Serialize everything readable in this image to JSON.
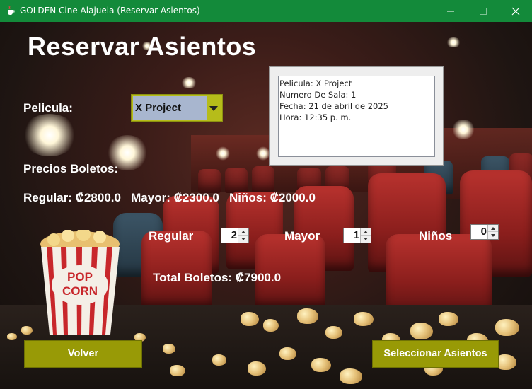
{
  "window": {
    "title": "GOLDEN Cine Alajuela (Reservar Asientos)",
    "controls": [
      "minimize",
      "maximize",
      "close"
    ]
  },
  "page": {
    "heading": "Reservar Asientos"
  },
  "movie": {
    "label": "Pelicula:",
    "selected": "X Project"
  },
  "info": {
    "lines": [
      "Pelicula: X Project",
      "Numero De Sala: 1",
      "Fecha: 21 de abril  de 2025",
      "Hora: 12:35 p. m."
    ]
  },
  "prices": {
    "heading": "Precios Boletos:",
    "summary": "Regular: ₡2800.0   Mayor: ₡2300.0   Niños: ₡2000.0"
  },
  "tickets": {
    "regular_label": "Regular",
    "regular_value": "2",
    "mayor_label": "Mayor",
    "mayor_value": "1",
    "ninos_label": "Niños",
    "ninos_value": "0"
  },
  "total": {
    "text": "Total Boletos: ₡7900.0"
  },
  "buttons": {
    "back": "Volver",
    "select_seats": "Seleccionar Asientos"
  },
  "colors": {
    "titlebar": "#138a3a",
    "button": "#989a06",
    "combo_border": "#b6bc1a",
    "combo_field": "#a8b6cf"
  },
  "decor": {
    "bucket_text": "POP CORN"
  }
}
